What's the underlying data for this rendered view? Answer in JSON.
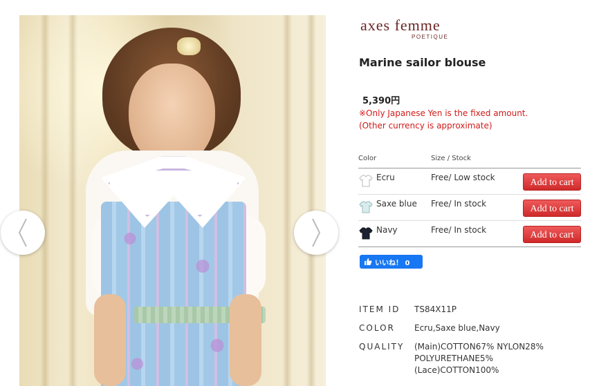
{
  "brand": {
    "name": "axes femme",
    "sub": "POETIQUE"
  },
  "product": {
    "title": "Marine sailor blouse",
    "price": "5,390円",
    "note_line1": "※Only Japanese Yen is the fixed amount.",
    "note_line2": "(Other currency is approximate)"
  },
  "variants_table": {
    "header_color": "Color",
    "header_size": "Size / Stock",
    "cart_label": "Add to cart",
    "rows": [
      {
        "color": "Ecru",
        "stock": "Free/ Low stock",
        "swatch": "#ffffff"
      },
      {
        "color": "Saxe blue",
        "stock": "Free/ In stock",
        "swatch": "#d8ecee"
      },
      {
        "color": "Navy",
        "stock": "Free/ In stock",
        "swatch": "#1b2233"
      }
    ]
  },
  "like_button": {
    "label": "いいね！ 0"
  },
  "specs": [
    {
      "key": "ITEM ID",
      "value": "TS84X11P"
    },
    {
      "key": "COLOR",
      "value": "Ecru,Saxe blue,Navy"
    },
    {
      "key": "QUALITY",
      "value": "(Main)COTTON67% NYLON28% POLYURETHANE5%",
      "value2": "(Lace)COTTON100%"
    }
  ],
  "gallery": {
    "prev_icon": "chevron-left-icon",
    "next_icon": "chevron-right-icon"
  },
  "colors": {
    "brand": "#6b2525",
    "cart_button": "#d9302e",
    "note": "#d11a1a",
    "like": "#1877f2"
  }
}
